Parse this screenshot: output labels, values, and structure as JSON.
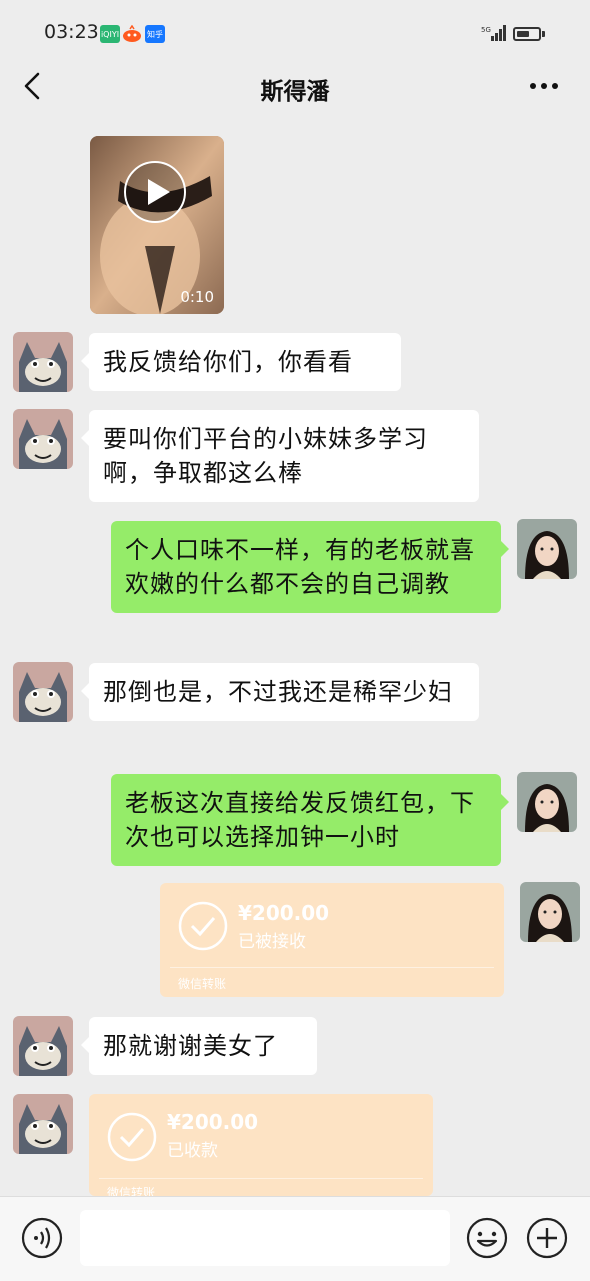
{
  "status_bar": {
    "time": "03:23",
    "app_icon_1": "iQIYI",
    "app_icon_3": "知乎",
    "network": "5G"
  },
  "header": {
    "title": "斯得潘"
  },
  "video": {
    "duration": "0:10"
  },
  "messages": [
    {
      "side": "left",
      "text": "我反馈给你们，你看看"
    },
    {
      "side": "left",
      "text": "要叫你们平台的小妹妹多学习啊，争取都这么棒"
    },
    {
      "side": "right",
      "text": "个人口味不一样，有的老板就喜欢嫩的什么都不会的自己调教"
    },
    {
      "side": "left",
      "text": "那倒也是，不过我还是稀罕少妇"
    },
    {
      "side": "right",
      "text": "老板这次直接给发反馈红包，下次也可以选择加钟一小时"
    },
    {
      "side": "left",
      "text": "那就谢谢美女了"
    }
  ],
  "transfers": [
    {
      "side": "right",
      "amount": "¥200.00",
      "status": "已被接收",
      "footer": "微信转账"
    },
    {
      "side": "left",
      "amount": "¥200.00",
      "status": "已收款",
      "footer": "微信转账"
    }
  ],
  "bottom_bar": {
    "placeholder": ""
  },
  "colors": {
    "background": "#ededed",
    "bubble_self": "#95ec69",
    "bubble_other": "#ffffff",
    "transfer_card": "#fde3c4"
  }
}
